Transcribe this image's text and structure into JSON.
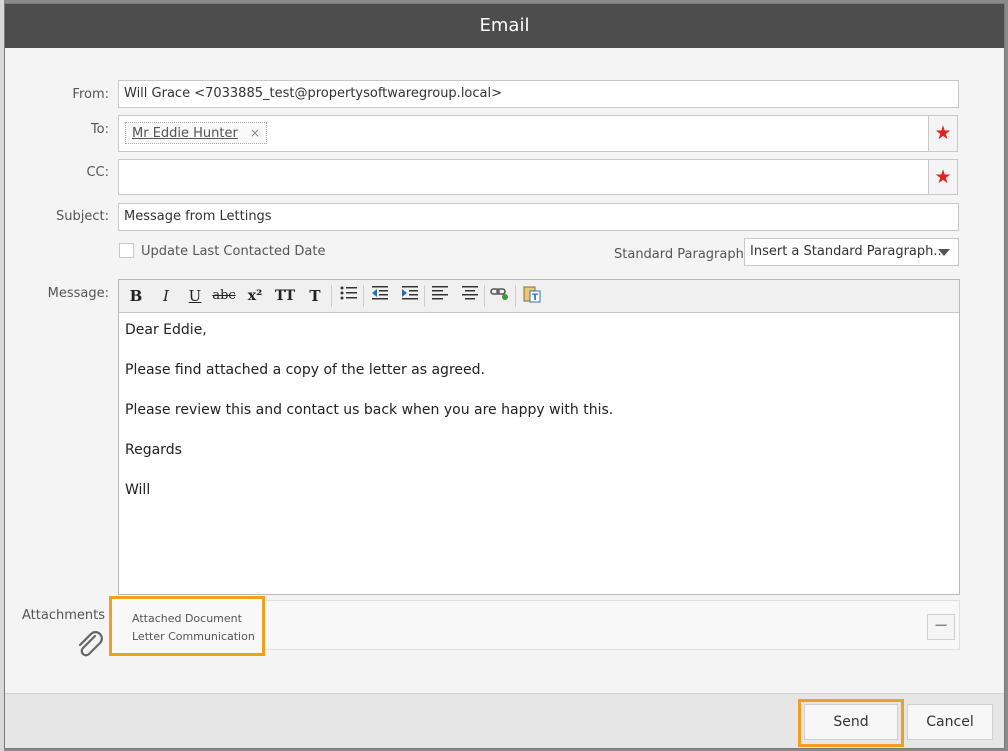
{
  "dialog": {
    "title": "Email"
  },
  "form": {
    "from_label": "From:",
    "from_value": "Will Grace <7033885_test@propertysoftwaregroup.local>",
    "to_label": "To:",
    "to_recipient": "Mr Eddie Hunter",
    "to_remove": "×",
    "cc_label": "CC:",
    "cc_value": "",
    "subject_label": "Subject:",
    "subject_value": "Message from Lettings",
    "update_contacted_label": "Update Last Contacted Date",
    "update_contacted_checked": false,
    "std_paragraphs_label": "Standard Paragraphs",
    "std_paragraphs_selected": "Insert a Standard Paragraph...",
    "message_label": "Message:",
    "required_icon": "star-icon",
    "required_color": "#e02424"
  },
  "toolbar": {
    "bold": "B",
    "italic": "I",
    "underline": "U",
    "strike": "abc",
    "superscript": "x²",
    "font_size": "TT",
    "font_color": "T"
  },
  "message": {
    "lines": [
      "Dear Eddie,",
      "Please find attached a copy of the letter as agreed.",
      "Please review this and contact us back when you are happy with this.",
      "Regards",
      "Will"
    ]
  },
  "attachments": {
    "label": "Attachments",
    "items": [
      "Attached Document",
      "Letter Communication"
    ],
    "remove_symbol": "−",
    "highlight_color": "#f0a020"
  },
  "footer": {
    "send_label": "Send",
    "cancel_label": "Cancel"
  }
}
